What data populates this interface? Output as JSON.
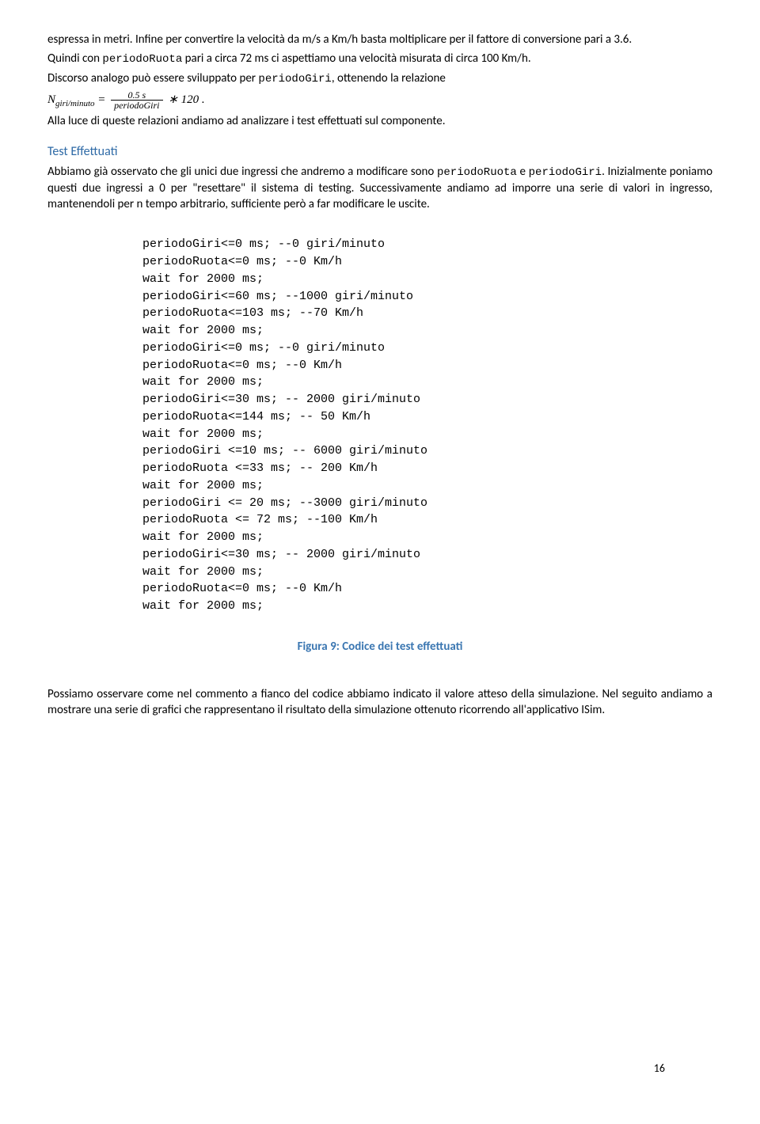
{
  "para1_a": "espressa in metri. Infine per convertire la velocità da m/s a Km/h basta moltiplicare per il fattore di conversione pari a 3.6.",
  "para2_a": "Quindi con ",
  "para2_mono": "periodoRuota",
  "para2_b": " pari a circa 72 ms ci aspettiamo una velocità misurata di circa 100 Km/h.",
  "para3_a": "Discorso analogo può essere sviluppato per ",
  "para3_mono": "periodoGiri",
  "para3_b": ", ottenendo la relazione",
  "formula_lhs_a": "N",
  "formula_lhs_sub": "giri/minuto",
  "formula_eq": " = ",
  "formula_num": "0.5 s",
  "formula_den": "periodoGiri",
  "formula_rhs": " ∗ 120 .",
  "para4": "Alla luce di queste relazioni andiamo ad analizzare i test effettuati sul componente.",
  "heading": "Test Effettuati",
  "para5_a": "Abbiamo già osservato che gli unici due ingressi che andremo a modificare sono ",
  "para5_mono1": "periodoRuota",
  "para5_b": " e ",
  "para5_mono2": "periodoGiri",
  "para5_c": ". Inizialmente poniamo questi due ingressi a 0 per \"resettare\" il sistema di testing. Successivamente andiamo ad imporre una serie di valori in ingresso, mantenendoli per n tempo arbitrario, sufficiente però a far modificare le uscite.",
  "code": [
    "periodoGiri<=0 ms; --0 giri/minuto",
    "periodoRuota<=0 ms; --0 Km/h",
    "wait for 2000 ms;",
    "periodoGiri<=60 ms; --1000 giri/minuto",
    "periodoRuota<=103 ms; --70 Km/h",
    "wait for 2000 ms;",
    "periodoGiri<=0 ms; --0 giri/minuto",
    "periodoRuota<=0 ms; --0 Km/h",
    "wait for 2000 ms;",
    "periodoGiri<=30 ms; -- 2000 giri/minuto",
    "periodoRuota<=144 ms; -- 50 Km/h",
    "wait for 2000 ms;",
    "periodoGiri <=10 ms; -- 6000 giri/minuto",
    "periodoRuota <=33 ms; -- 200 Km/h",
    "wait for 2000 ms;",
    "periodoGiri <= 20 ms; --3000 giri/minuto",
    "periodoRuota <= 72 ms; --100 Km/h",
    "wait for 2000 ms;",
    "periodoGiri<=30 ms; -- 2000 giri/minuto",
    "wait for 2000 ms;",
    "periodoRuota<=0 ms; --0 Km/h",
    "wait for 2000 ms;"
  ],
  "caption": "Figura 9: Codice dei test effettuati",
  "para6": "Possiamo osservare come nel commento a fianco del codice abbiamo indicato il valore atteso della simulazione. Nel seguito andiamo a mostrare una serie di grafici che rappresentano il risultato della simulazione ottenuto ricorrendo all'applicativo ISim.",
  "page_number": "16"
}
